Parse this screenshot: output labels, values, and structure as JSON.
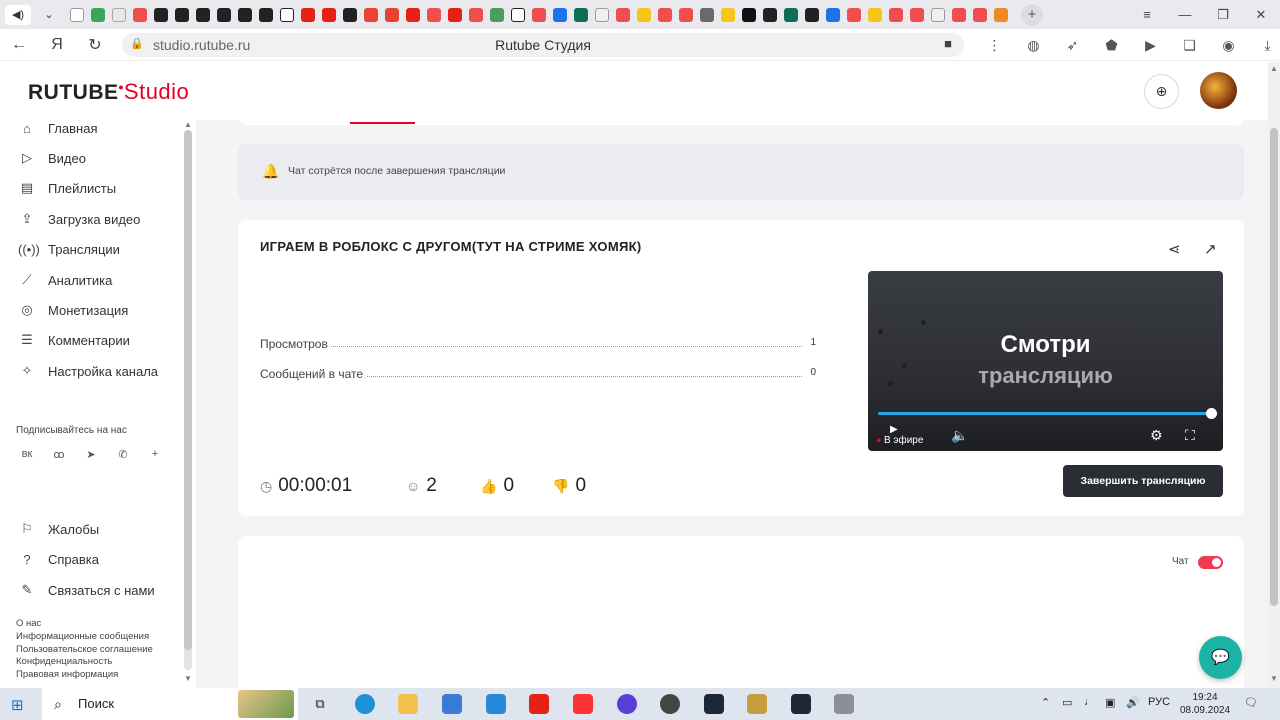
{
  "browser": {
    "url": "studio.rutube.ru",
    "page_title": "Rutube Студия"
  },
  "header": {
    "logo_main": "RUTUBE",
    "logo_studio": "Studio"
  },
  "sidebar": {
    "items": [
      {
        "label": "Главная",
        "icon": "home-icon"
      },
      {
        "label": "Видео",
        "icon": "video-icon"
      },
      {
        "label": "Плейлисты",
        "icon": "playlist-icon"
      },
      {
        "label": "Загрузка видео",
        "icon": "upload-icon"
      },
      {
        "label": "Трансляции",
        "icon": "broadcast-icon"
      },
      {
        "label": "Аналитика",
        "icon": "analytics-icon"
      },
      {
        "label": "Монетизация",
        "icon": "monetization-icon"
      },
      {
        "label": "Комментарии",
        "icon": "comments-icon"
      },
      {
        "label": "Настройка канала",
        "icon": "settings-wand-icon"
      }
    ],
    "subscribe_heading": "Подписывайтесь на нас",
    "bottom_items": [
      {
        "label": "Жалобы",
        "icon": "complaint-icon"
      },
      {
        "label": "Справка",
        "icon": "help-icon"
      },
      {
        "label": "Связаться с нами",
        "icon": "contact-icon"
      }
    ],
    "footer_links": [
      "О нас",
      "Информационные сообщения",
      "Пользовательское соглашение",
      "Конфиденциальность",
      "Правовая информация"
    ]
  },
  "notice": {
    "text": "Чат сотрётся после завершения трансляции"
  },
  "stream": {
    "title": "ИГРАЕМ В РОБЛОКС С ДРУГОМ(ТУТ НА СТРИМЕ ХОМЯК)",
    "stats": [
      {
        "label": "Просмотров",
        "value": "1"
      },
      {
        "label": "Сообщений в чате",
        "value": "0"
      }
    ],
    "player": {
      "cta_line1": "Смотри",
      "cta_line2": "трансляцию",
      "live_label": "В эфире",
      "progress": 1.0
    },
    "metrics": {
      "duration": "00:00:01",
      "viewers": "2",
      "likes": "0",
      "dislikes": "0"
    },
    "end_button": "Завершить трансляцию"
  },
  "chat": {
    "toggle_label": "Чат",
    "enabled": true
  },
  "taskbar": {
    "search_label": "Поиск",
    "language": "РУС",
    "time": "19:24",
    "date": "08.09.2024"
  },
  "colors": {
    "brand_red": "#e5002b",
    "toggle_red": "#ef3b4f",
    "end_button": "#2a2d33",
    "progress_blue": "#2aa3ea",
    "help_teal": "#1bb3a6"
  }
}
